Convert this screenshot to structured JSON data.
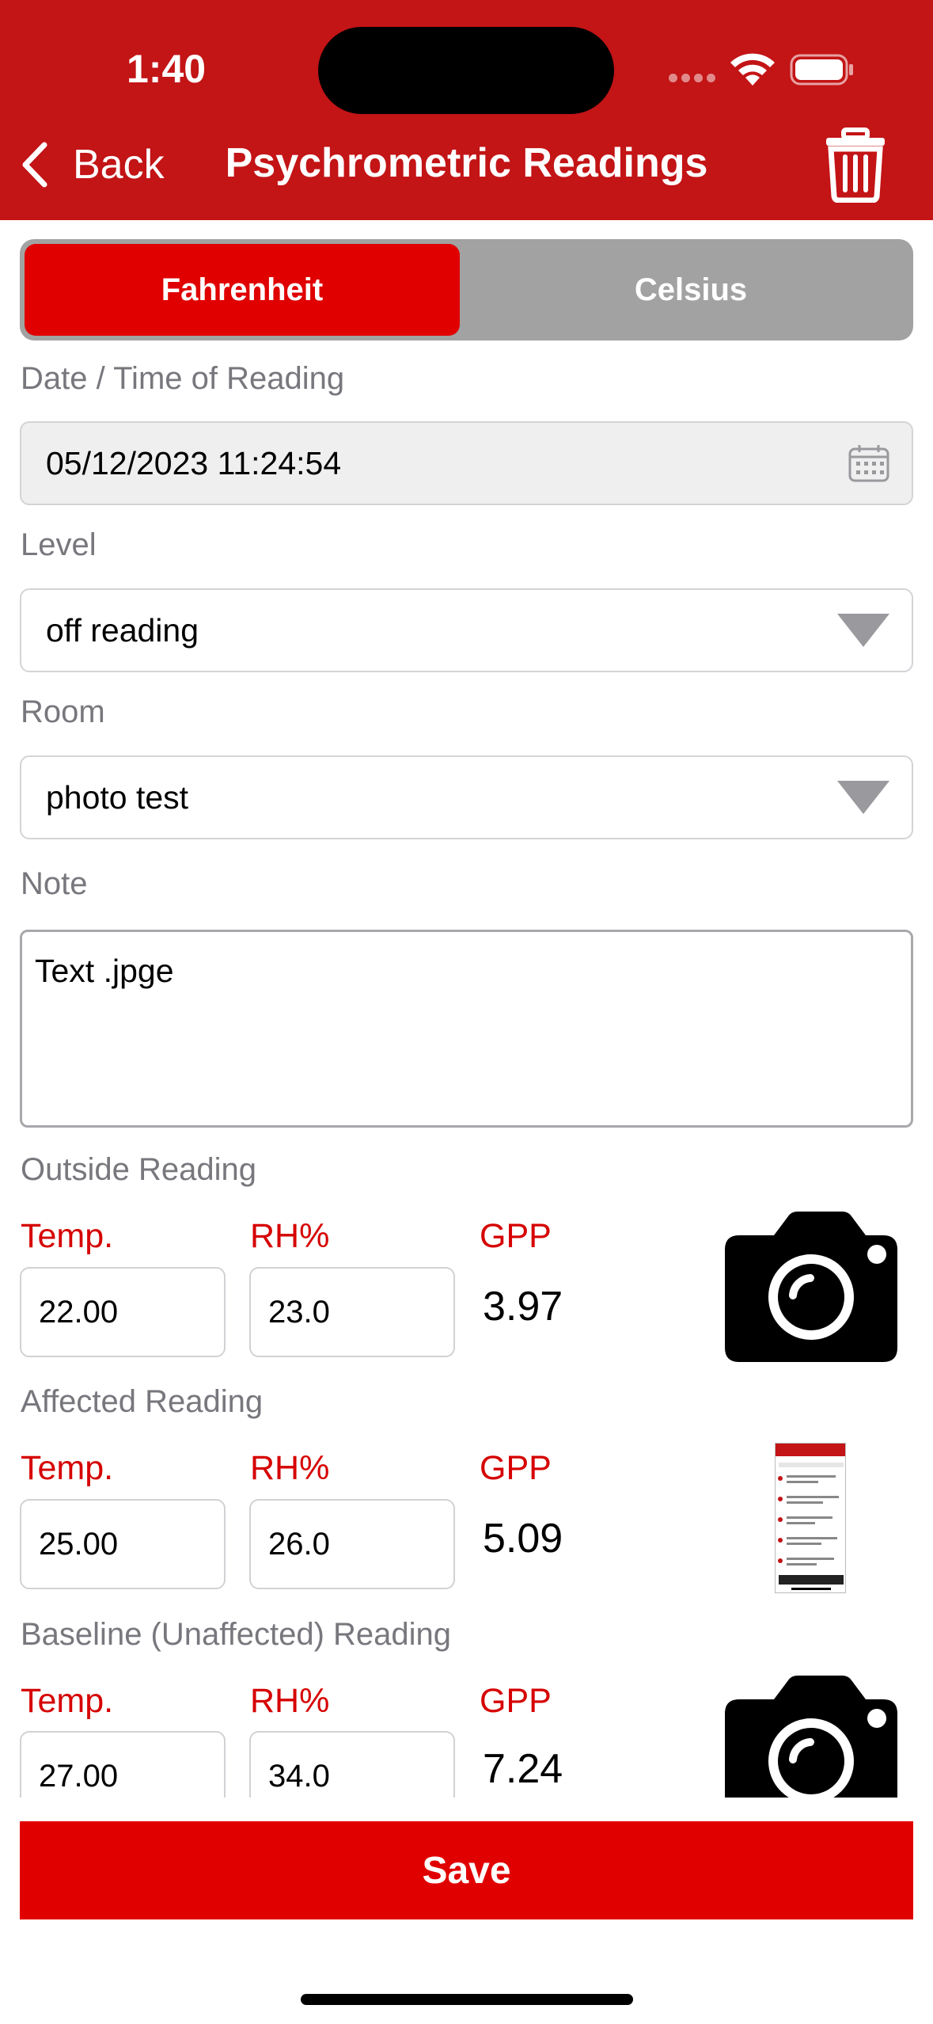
{
  "status_bar": {
    "time": "1:40"
  },
  "header": {
    "back_label": "Back",
    "title": "Psychrometric Readings"
  },
  "units": {
    "options": [
      "Fahrenheit",
      "Celsius"
    ],
    "selected": "Fahrenheit"
  },
  "form": {
    "datetime": {
      "label": "Date / Time of Reading",
      "value": "05/12/2023 11:24:54"
    },
    "level": {
      "label": "Level",
      "value": "off reading"
    },
    "room": {
      "label": "Room",
      "value": "photo test"
    },
    "note": {
      "label": "Note",
      "value": "Text .jpge"
    }
  },
  "readings": [
    {
      "title": "Outside Reading",
      "temp_label": "Temp.",
      "rh_label": "RH%",
      "gpp_label": "GPP",
      "temp": "22.00",
      "rh": "23.0",
      "gpp": "3.97",
      "photo": "camera-icon"
    },
    {
      "title": "Affected Reading",
      "temp_label": "Temp.",
      "rh_label": "RH%",
      "gpp_label": "GPP",
      "temp": "25.00",
      "rh": "26.0",
      "gpp": "5.09",
      "photo": "photo-thumbnail"
    },
    {
      "title": "Baseline (Unaffected) Reading",
      "temp_label": "Temp.",
      "rh_label": "RH%",
      "gpp_label": "GPP",
      "temp": "27.00",
      "rh": "34.0",
      "gpp": "7.24",
      "photo": "camera-icon"
    }
  ],
  "actions": {
    "save_label": "Save"
  },
  "colors": {
    "brand": "#c31416",
    "accent": "#e10000",
    "segment_inactive": "#a2a2a2"
  }
}
